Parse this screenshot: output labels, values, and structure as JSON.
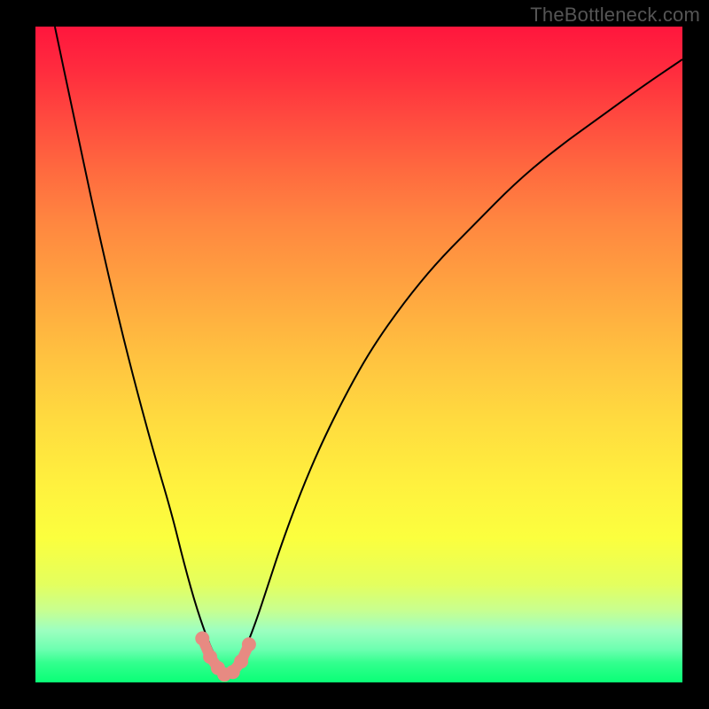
{
  "watermark": "TheBottleneck.com",
  "colors": {
    "frame": "#000000",
    "curve": "#000000",
    "marker_fill": "#e78a82",
    "marker_stroke": "#e78a82"
  },
  "chart_data": {
    "type": "line",
    "title": "",
    "xlabel": "",
    "ylabel": "",
    "xlim": [
      0,
      100
    ],
    "ylim": [
      0,
      100
    ],
    "grid": false,
    "legend": false,
    "series": [
      {
        "name": "bottleneck-curve",
        "x": [
          3,
          6,
          9,
          12,
          15,
          18,
          21,
          23,
          25,
          27,
          28.5,
          30,
          31,
          32,
          34,
          36,
          38,
          41,
          44,
          48,
          52,
          57,
          62,
          68,
          74,
          80,
          87,
          94,
          100
        ],
        "y": [
          100,
          86,
          72,
          59,
          47,
          36,
          26,
          18,
          11,
          5.5,
          2.5,
          1.2,
          2,
          4,
          9,
          15,
          21,
          29,
          36,
          44,
          51,
          58,
          64,
          70,
          76,
          81,
          86,
          91,
          95
        ]
      }
    ],
    "markers": {
      "name": "valley-markers",
      "x": [
        25.8,
        27.0,
        28.2,
        29.2,
        30.5,
        31.8,
        33.0
      ],
      "y": [
        6.7,
        3.9,
        2.2,
        1.2,
        1.6,
        3.2,
        5.8
      ]
    },
    "background_gradient": {
      "top": "#ff163d",
      "bottom": "#09ff76"
    }
  }
}
